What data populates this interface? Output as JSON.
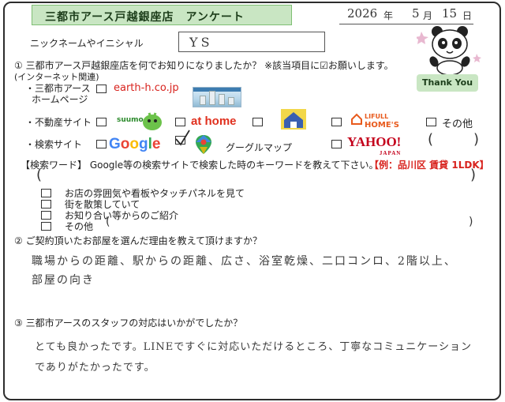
{
  "header": {
    "title": "三都市アース戸越銀座店　アンケート",
    "date_year": "2026",
    "date_year_unit": "年",
    "date_month": "5",
    "date_month_unit": "月",
    "date_day": "15",
    "date_day_unit": "日"
  },
  "nickname": {
    "label": "ニックネームやイニシャル",
    "value": "YS"
  },
  "thank_you": "Thank You",
  "q1": {
    "question": "① 三都市アース戸越銀座店を何でお知りになりましたか？ ※該当項目に☑お願いします。",
    "internet_label": "(インターネット関連)",
    "homepage_label_1": "・三都市アース",
    "homepage_label_2": "ホームページ",
    "homepage_site": "earth-h.co.jp",
    "realestate_label": "・不動産サイト",
    "suumo": "suumo",
    "athome": "at home",
    "lifull_1": "LIFULL",
    "lifull_2": "HOME'S",
    "other_label": "その他",
    "search_label": "・検索サイト",
    "google": "Google",
    "google_checked": true,
    "googlemap": "グーグルマップ",
    "yahoo": "YAHOO!",
    "yahoo_sub": "JAPAN",
    "paren_open": "(",
    "paren_close": ")",
    "keyword_label": "【検索ワード】 Google等の検索サイトで検索した時のキーワードを教えて下さい。",
    "keyword_example": "【例：品川区 賃貸 1LDK】",
    "offline_options": [
      "お店の雰囲気や看板やタッチパネルを見て",
      "街を散策していて",
      "お知り合い等からのご紹介",
      "その他"
    ]
  },
  "q2": {
    "question": "② ご契約頂いたお部屋を選んだ理由を教えて頂けますか？",
    "answer_line1": "職場からの距離、駅からの距離、広さ、浴室乾燥、二口コンロ、2階以上、",
    "answer_line2": "部屋の向き"
  },
  "q3": {
    "question": "③ 三都市アースのスタッフの対応はいかがでしたか？",
    "answer_line1": "とても良かったです。LINEですぐに対応いただけるところ、丁寧なコミュニケーション",
    "answer_line2": "でありがたかったです。"
  },
  "colors": {
    "title_bg": "#c9e6c3",
    "border": "#2d2d2d",
    "keyword_red": "#d8231e"
  }
}
